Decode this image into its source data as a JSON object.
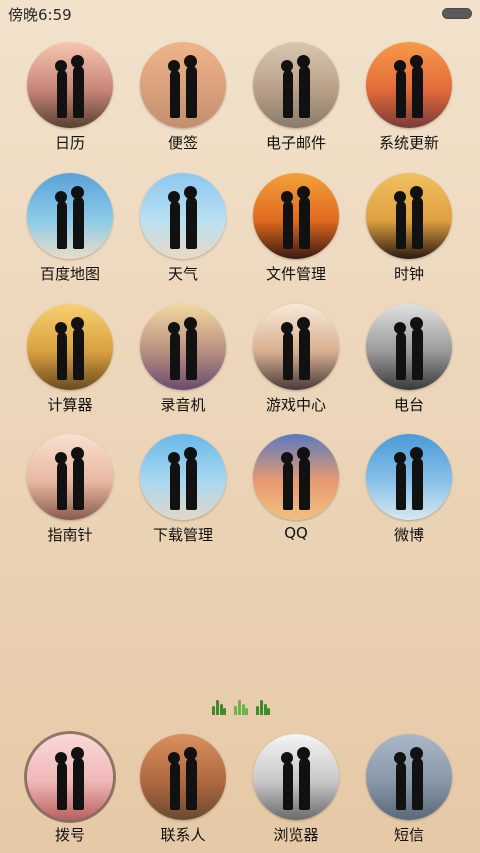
{
  "status": {
    "time": "傍晚6:59"
  },
  "apps": [
    {
      "label": "日历",
      "icon": "couple-sunset-photo-icon",
      "bg": [
        "#f5c6b0",
        "#c9867a",
        "#5a4030"
      ]
    },
    {
      "label": "便签",
      "icon": "couple-walking-beach-icon",
      "bg": [
        "#f0b48a",
        "#d8a07c",
        "#c48f6f"
      ]
    },
    {
      "label": "电子邮件",
      "icon": "couple-street-icon",
      "bg": [
        "#d9c7b0",
        "#b8a088",
        "#8a7a6a"
      ]
    },
    {
      "label": "系统更新",
      "icon": "couple-sea-sunset-icon",
      "bg": [
        "#f79a4a",
        "#e36b3a",
        "#7a3a3a"
      ]
    },
    {
      "label": "百度地图",
      "icon": "couple-blue-beach-icon",
      "bg": [
        "#5aa3d8",
        "#8ccbe8",
        "#e9ddc8"
      ]
    },
    {
      "label": "天气",
      "icon": "couple-umbrella-beach-icon",
      "bg": [
        "#8cc8f0",
        "#b9dff2",
        "#e8dac4"
      ]
    },
    {
      "label": "文件管理",
      "icon": "couple-orange-sunset-icon",
      "bg": [
        "#f2a13a",
        "#e06a1e",
        "#3a1a10"
      ]
    },
    {
      "label": "时钟",
      "icon": "couple-silhouette-icon",
      "bg": [
        "#f0c060",
        "#e0a040",
        "#2a1a10"
      ]
    },
    {
      "label": "计算器",
      "icon": "couple-kiss-golden-icon",
      "bg": [
        "#f7d070",
        "#d9a040",
        "#6a4a20"
      ]
    },
    {
      "label": "录音机",
      "icon": "couple-bokeh-icon",
      "bg": [
        "#f2d8a0",
        "#b89080",
        "#6a4a70"
      ]
    },
    {
      "label": "游戏中心",
      "icon": "couple-sunlight-icon",
      "bg": [
        "#f7e8d8",
        "#d8b090",
        "#4a3a3a"
      ]
    },
    {
      "label": "电台",
      "icon": "couple-train-bw-icon",
      "bg": [
        "#e0e0e0",
        "#9a9a9a",
        "#3a3a3a"
      ]
    },
    {
      "label": "指南针",
      "icon": "couple-heart-hands-icon",
      "bg": [
        "#f8e0d0",
        "#e8b8a0",
        "#8a5a50"
      ]
    },
    {
      "label": "下载管理",
      "icon": "couple-sitting-beach-icon",
      "bg": [
        "#6ab8e8",
        "#a8d8f0",
        "#e0d8c8"
      ]
    },
    {
      "label": "QQ",
      "icon": "couple-holding-hands-icon",
      "bg": [
        "#5a7ac0",
        "#e89a70",
        "#f0c080"
      ]
    },
    {
      "label": "微博",
      "icon": "bride-groom-beach-icon",
      "bg": [
        "#4a9ad8",
        "#88c0e8",
        "#d8e8f0"
      ]
    }
  ],
  "dock": [
    {
      "label": "拨号",
      "icon": "proposal-silhouette-icon",
      "bg": [
        "#f9d8d8",
        "#f0b8b8",
        "#b86060"
      ]
    },
    {
      "label": "联系人",
      "icon": "couple-autumn-path-icon",
      "bg": [
        "#d89060",
        "#b06840",
        "#6a4a30"
      ]
    },
    {
      "label": "浏览器",
      "icon": "couple-beach-bw-icon",
      "bg": [
        "#f4f4f4",
        "#c8c8c8",
        "#6a6a6a"
      ]
    },
    {
      "label": "短信",
      "icon": "couple-gray-sea-icon",
      "bg": [
        "#a8b8c8",
        "#8898a8",
        "#5a6878"
      ]
    }
  ],
  "page_indicator": {
    "count": 3,
    "active": 1
  }
}
